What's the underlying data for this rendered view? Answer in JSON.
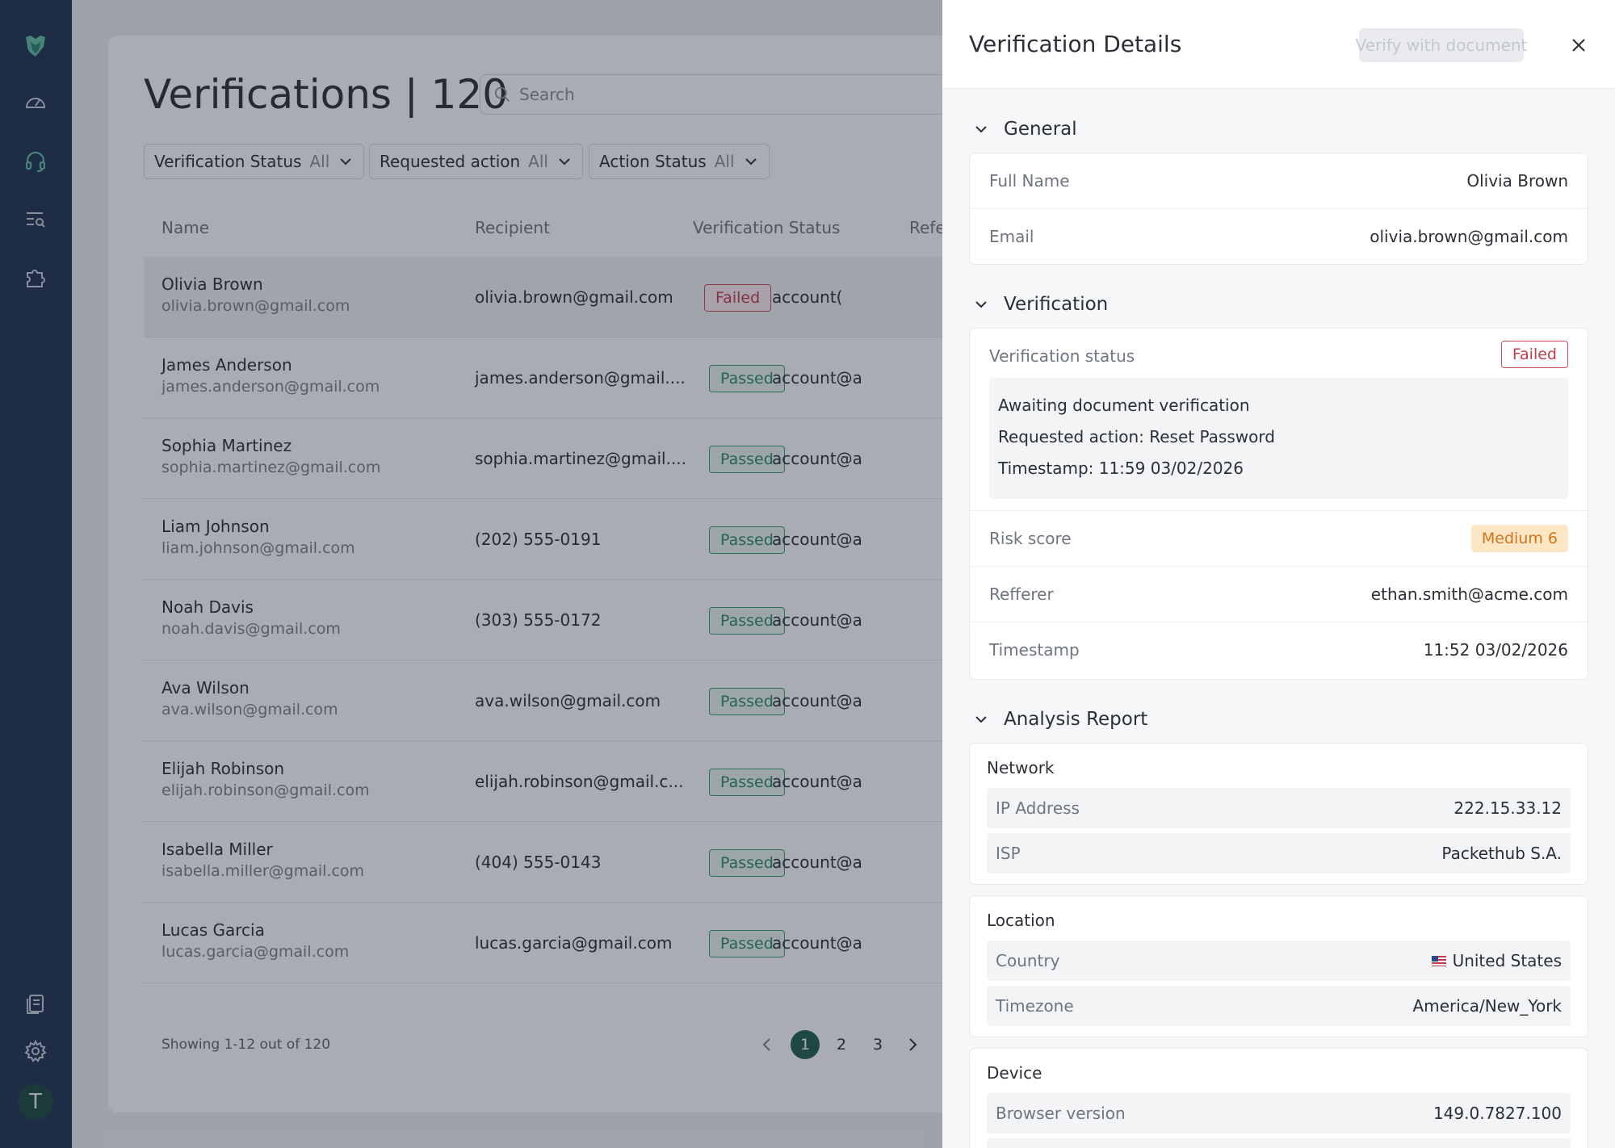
{
  "sidebar": {
    "items": [
      {
        "icon": "dashboard-gauge-icon"
      },
      {
        "icon": "headset-icon"
      },
      {
        "icon": "search-list-icon"
      },
      {
        "icon": "puzzle-icon"
      },
      {
        "icon": "documents-icon"
      },
      {
        "icon": "gear-icon"
      }
    ],
    "avatar_initial": "T"
  },
  "page": {
    "title": "Verifications | 120",
    "search_placeholder": "Search",
    "filters": [
      {
        "label": "Verification Status",
        "value": "All"
      },
      {
        "label": "Requested action",
        "value": "All"
      },
      {
        "label": "Action Status",
        "value": "All"
      }
    ],
    "columns": [
      "Name",
      "Recipient",
      "Verification Status",
      "Refe"
    ],
    "rows": [
      {
        "name": "Olivia Brown",
        "email": "olivia.brown@gmail.com",
        "recipient": "olivia.brown@gmail.com",
        "status": "Failed",
        "ref": "account("
      },
      {
        "name": "James Anderson",
        "email": "james.anderson@gmail.com",
        "recipient": "james.anderson@gmail....",
        "status": "Passed",
        "ref": "account@a"
      },
      {
        "name": "Sophia Martinez",
        "email": "sophia.martinez@gmail.com",
        "recipient": "sophia.martinez@gmail....",
        "status": "Passed",
        "ref": "account@a"
      },
      {
        "name": "Liam Johnson",
        "email": "liam.johnson@gmail.com",
        "recipient": "(202) 555-0191",
        "status": "Passed",
        "ref": "account@a"
      },
      {
        "name": "Noah Davis",
        "email": "noah.davis@gmail.com",
        "recipient": "(303) 555-0172",
        "status": "Passed",
        "ref": "account@a"
      },
      {
        "name": "Ava Wilson",
        "email": "ava.wilson@gmail.com",
        "recipient": "ava.wilson@gmail.com",
        "status": "Passed",
        "ref": "account@a"
      },
      {
        "name": "Elijah Robinson",
        "email": "elijah.robinson@gmail.com",
        "recipient": "elijah.robinson@gmail.c...",
        "status": "Passed",
        "ref": "account@a"
      },
      {
        "name": "Isabella Miller",
        "email": "isabella.miller@gmail.com",
        "recipient": "(404) 555-0143",
        "status": "Passed",
        "ref": "account@a"
      },
      {
        "name": "Lucas Garcia",
        "email": "lucas.garcia@gmail.com",
        "recipient": "lucas.garcia@gmail.com",
        "status": "Passed",
        "ref": "account@a"
      }
    ],
    "showing": "Showing 1-12 out of 120",
    "pages": [
      "1",
      "2",
      "3"
    ],
    "current_page": "1"
  },
  "drawer": {
    "title": "Verification Details",
    "verify_button": "Verify with document",
    "general": {
      "heading": "General",
      "full_name_label": "Full Name",
      "full_name": "Olivia Brown",
      "email_label": "Email",
      "email": "olivia.brown@gmail.com"
    },
    "verification": {
      "heading": "Verification",
      "status_label": "Verification status",
      "status": "Failed",
      "note_line1": "Awaiting document verification",
      "note_line2": "Requested action: Reset Password",
      "note_line3": "Timestamp: 11:59 03/02/2026",
      "risk_label": "Risk score",
      "risk": "Medium 6",
      "referrer_label": "Refferer",
      "referrer": "ethan.smith@acme.com",
      "timestamp_label": "Timestamp",
      "timestamp": "11:52 03/02/2026"
    },
    "analysis": {
      "heading": "Analysis Report",
      "network_title": "Network",
      "ip_label": "IP Address",
      "ip": "222.15.33.12",
      "isp_label": "ISP",
      "isp": "Packethub S.A.",
      "location_title": "Location",
      "country_label": "Country",
      "country": "United States",
      "timezone_label": "Timezone",
      "timezone": "America/New_York",
      "device_title": "Device",
      "browser_label": "Browser version",
      "browser": "149.0.7827.100"
    }
  },
  "colors": {
    "sidebar_bg": "#1f3350",
    "accent_green": "#1e5e4c",
    "passed": "#2e8a6a",
    "failed": "#c43a4c",
    "medium_risk_bg": "#fde6c4",
    "medium_risk_text": "#d2741b"
  }
}
